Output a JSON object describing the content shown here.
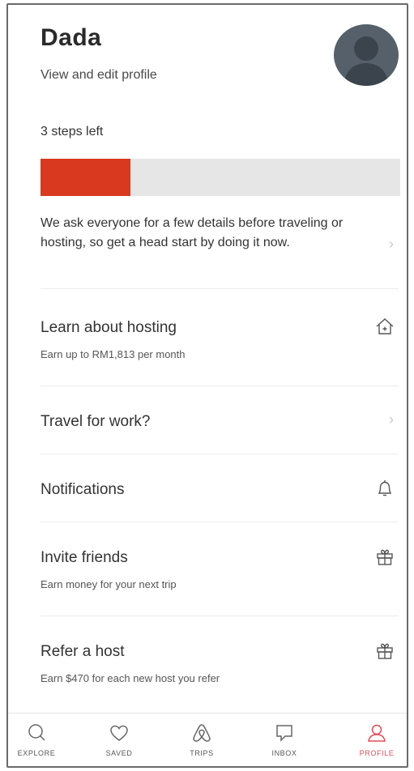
{
  "profile": {
    "name": "Dada",
    "view_edit": "View and edit profile"
  },
  "onboarding": {
    "steps_left": "3 steps left",
    "progress": 0.25,
    "progress_color": "#d9391f",
    "info": "We ask everyone for a few details before traveling or hosting, so get a head start by doing it now."
  },
  "menu": {
    "hosting": {
      "title": "Learn about hosting",
      "subtitle": "Earn up to RM1,813 per month",
      "icon": "house-icon"
    },
    "travel": {
      "title": "Travel for work?",
      "icon": "chevron-right-icon"
    },
    "notifications": {
      "title": "Notifications",
      "icon": "bell-icon"
    },
    "invite": {
      "title": "Invite friends",
      "subtitle": "Earn money for your next trip",
      "icon": "gift-icon"
    },
    "refer": {
      "title": "Refer a host",
      "subtitle": "Earn $470 for each new host you refer",
      "icon": "gift-icon"
    }
  },
  "tabs": [
    {
      "label": "EXPLORE",
      "icon": "search-icon"
    },
    {
      "label": "SAVED",
      "icon": "heart-icon"
    },
    {
      "label": "TRIPS",
      "icon": "airbnb-logo-icon"
    },
    {
      "label": "INBOX",
      "icon": "message-icon"
    },
    {
      "label": "PROFILE",
      "icon": "user-icon",
      "active": true
    }
  ],
  "accent_color": "#e14c5a"
}
